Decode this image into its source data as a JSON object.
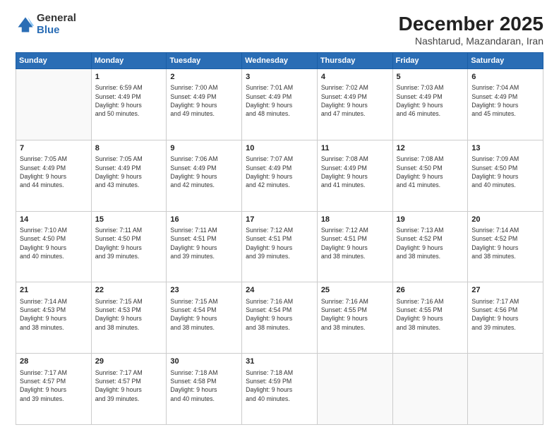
{
  "header": {
    "logo": {
      "general": "General",
      "blue": "Blue"
    },
    "title": "December 2025",
    "subtitle": "Nashtarud, Mazandaran, Iran"
  },
  "calendar": {
    "days_of_week": [
      "Sunday",
      "Monday",
      "Tuesday",
      "Wednesday",
      "Thursday",
      "Friday",
      "Saturday"
    ],
    "weeks": [
      [
        {
          "day": "",
          "info": ""
        },
        {
          "day": "1",
          "info": "Sunrise: 6:59 AM\nSunset: 4:49 PM\nDaylight: 9 hours\nand 50 minutes."
        },
        {
          "day": "2",
          "info": "Sunrise: 7:00 AM\nSunset: 4:49 PM\nDaylight: 9 hours\nand 49 minutes."
        },
        {
          "day": "3",
          "info": "Sunrise: 7:01 AM\nSunset: 4:49 PM\nDaylight: 9 hours\nand 48 minutes."
        },
        {
          "day": "4",
          "info": "Sunrise: 7:02 AM\nSunset: 4:49 PM\nDaylight: 9 hours\nand 47 minutes."
        },
        {
          "day": "5",
          "info": "Sunrise: 7:03 AM\nSunset: 4:49 PM\nDaylight: 9 hours\nand 46 minutes."
        },
        {
          "day": "6",
          "info": "Sunrise: 7:04 AM\nSunset: 4:49 PM\nDaylight: 9 hours\nand 45 minutes."
        }
      ],
      [
        {
          "day": "7",
          "info": "Sunrise: 7:05 AM\nSunset: 4:49 PM\nDaylight: 9 hours\nand 44 minutes."
        },
        {
          "day": "8",
          "info": "Sunrise: 7:05 AM\nSunset: 4:49 PM\nDaylight: 9 hours\nand 43 minutes."
        },
        {
          "day": "9",
          "info": "Sunrise: 7:06 AM\nSunset: 4:49 PM\nDaylight: 9 hours\nand 42 minutes."
        },
        {
          "day": "10",
          "info": "Sunrise: 7:07 AM\nSunset: 4:49 PM\nDaylight: 9 hours\nand 42 minutes."
        },
        {
          "day": "11",
          "info": "Sunrise: 7:08 AM\nSunset: 4:49 PM\nDaylight: 9 hours\nand 41 minutes."
        },
        {
          "day": "12",
          "info": "Sunrise: 7:08 AM\nSunset: 4:50 PM\nDaylight: 9 hours\nand 41 minutes."
        },
        {
          "day": "13",
          "info": "Sunrise: 7:09 AM\nSunset: 4:50 PM\nDaylight: 9 hours\nand 40 minutes."
        }
      ],
      [
        {
          "day": "14",
          "info": "Sunrise: 7:10 AM\nSunset: 4:50 PM\nDaylight: 9 hours\nand 40 minutes."
        },
        {
          "day": "15",
          "info": "Sunrise: 7:11 AM\nSunset: 4:50 PM\nDaylight: 9 hours\nand 39 minutes."
        },
        {
          "day": "16",
          "info": "Sunrise: 7:11 AM\nSunset: 4:51 PM\nDaylight: 9 hours\nand 39 minutes."
        },
        {
          "day": "17",
          "info": "Sunrise: 7:12 AM\nSunset: 4:51 PM\nDaylight: 9 hours\nand 39 minutes."
        },
        {
          "day": "18",
          "info": "Sunrise: 7:12 AM\nSunset: 4:51 PM\nDaylight: 9 hours\nand 38 minutes."
        },
        {
          "day": "19",
          "info": "Sunrise: 7:13 AM\nSunset: 4:52 PM\nDaylight: 9 hours\nand 38 minutes."
        },
        {
          "day": "20",
          "info": "Sunrise: 7:14 AM\nSunset: 4:52 PM\nDaylight: 9 hours\nand 38 minutes."
        }
      ],
      [
        {
          "day": "21",
          "info": "Sunrise: 7:14 AM\nSunset: 4:53 PM\nDaylight: 9 hours\nand 38 minutes."
        },
        {
          "day": "22",
          "info": "Sunrise: 7:15 AM\nSunset: 4:53 PM\nDaylight: 9 hours\nand 38 minutes."
        },
        {
          "day": "23",
          "info": "Sunrise: 7:15 AM\nSunset: 4:54 PM\nDaylight: 9 hours\nand 38 minutes."
        },
        {
          "day": "24",
          "info": "Sunrise: 7:16 AM\nSunset: 4:54 PM\nDaylight: 9 hours\nand 38 minutes."
        },
        {
          "day": "25",
          "info": "Sunrise: 7:16 AM\nSunset: 4:55 PM\nDaylight: 9 hours\nand 38 minutes."
        },
        {
          "day": "26",
          "info": "Sunrise: 7:16 AM\nSunset: 4:55 PM\nDaylight: 9 hours\nand 38 minutes."
        },
        {
          "day": "27",
          "info": "Sunrise: 7:17 AM\nSunset: 4:56 PM\nDaylight: 9 hours\nand 39 minutes."
        }
      ],
      [
        {
          "day": "28",
          "info": "Sunrise: 7:17 AM\nSunset: 4:57 PM\nDaylight: 9 hours\nand 39 minutes."
        },
        {
          "day": "29",
          "info": "Sunrise: 7:17 AM\nSunset: 4:57 PM\nDaylight: 9 hours\nand 39 minutes."
        },
        {
          "day": "30",
          "info": "Sunrise: 7:18 AM\nSunset: 4:58 PM\nDaylight: 9 hours\nand 40 minutes."
        },
        {
          "day": "31",
          "info": "Sunrise: 7:18 AM\nSunset: 4:59 PM\nDaylight: 9 hours\nand 40 minutes."
        },
        {
          "day": "",
          "info": ""
        },
        {
          "day": "",
          "info": ""
        },
        {
          "day": "",
          "info": ""
        }
      ]
    ]
  }
}
